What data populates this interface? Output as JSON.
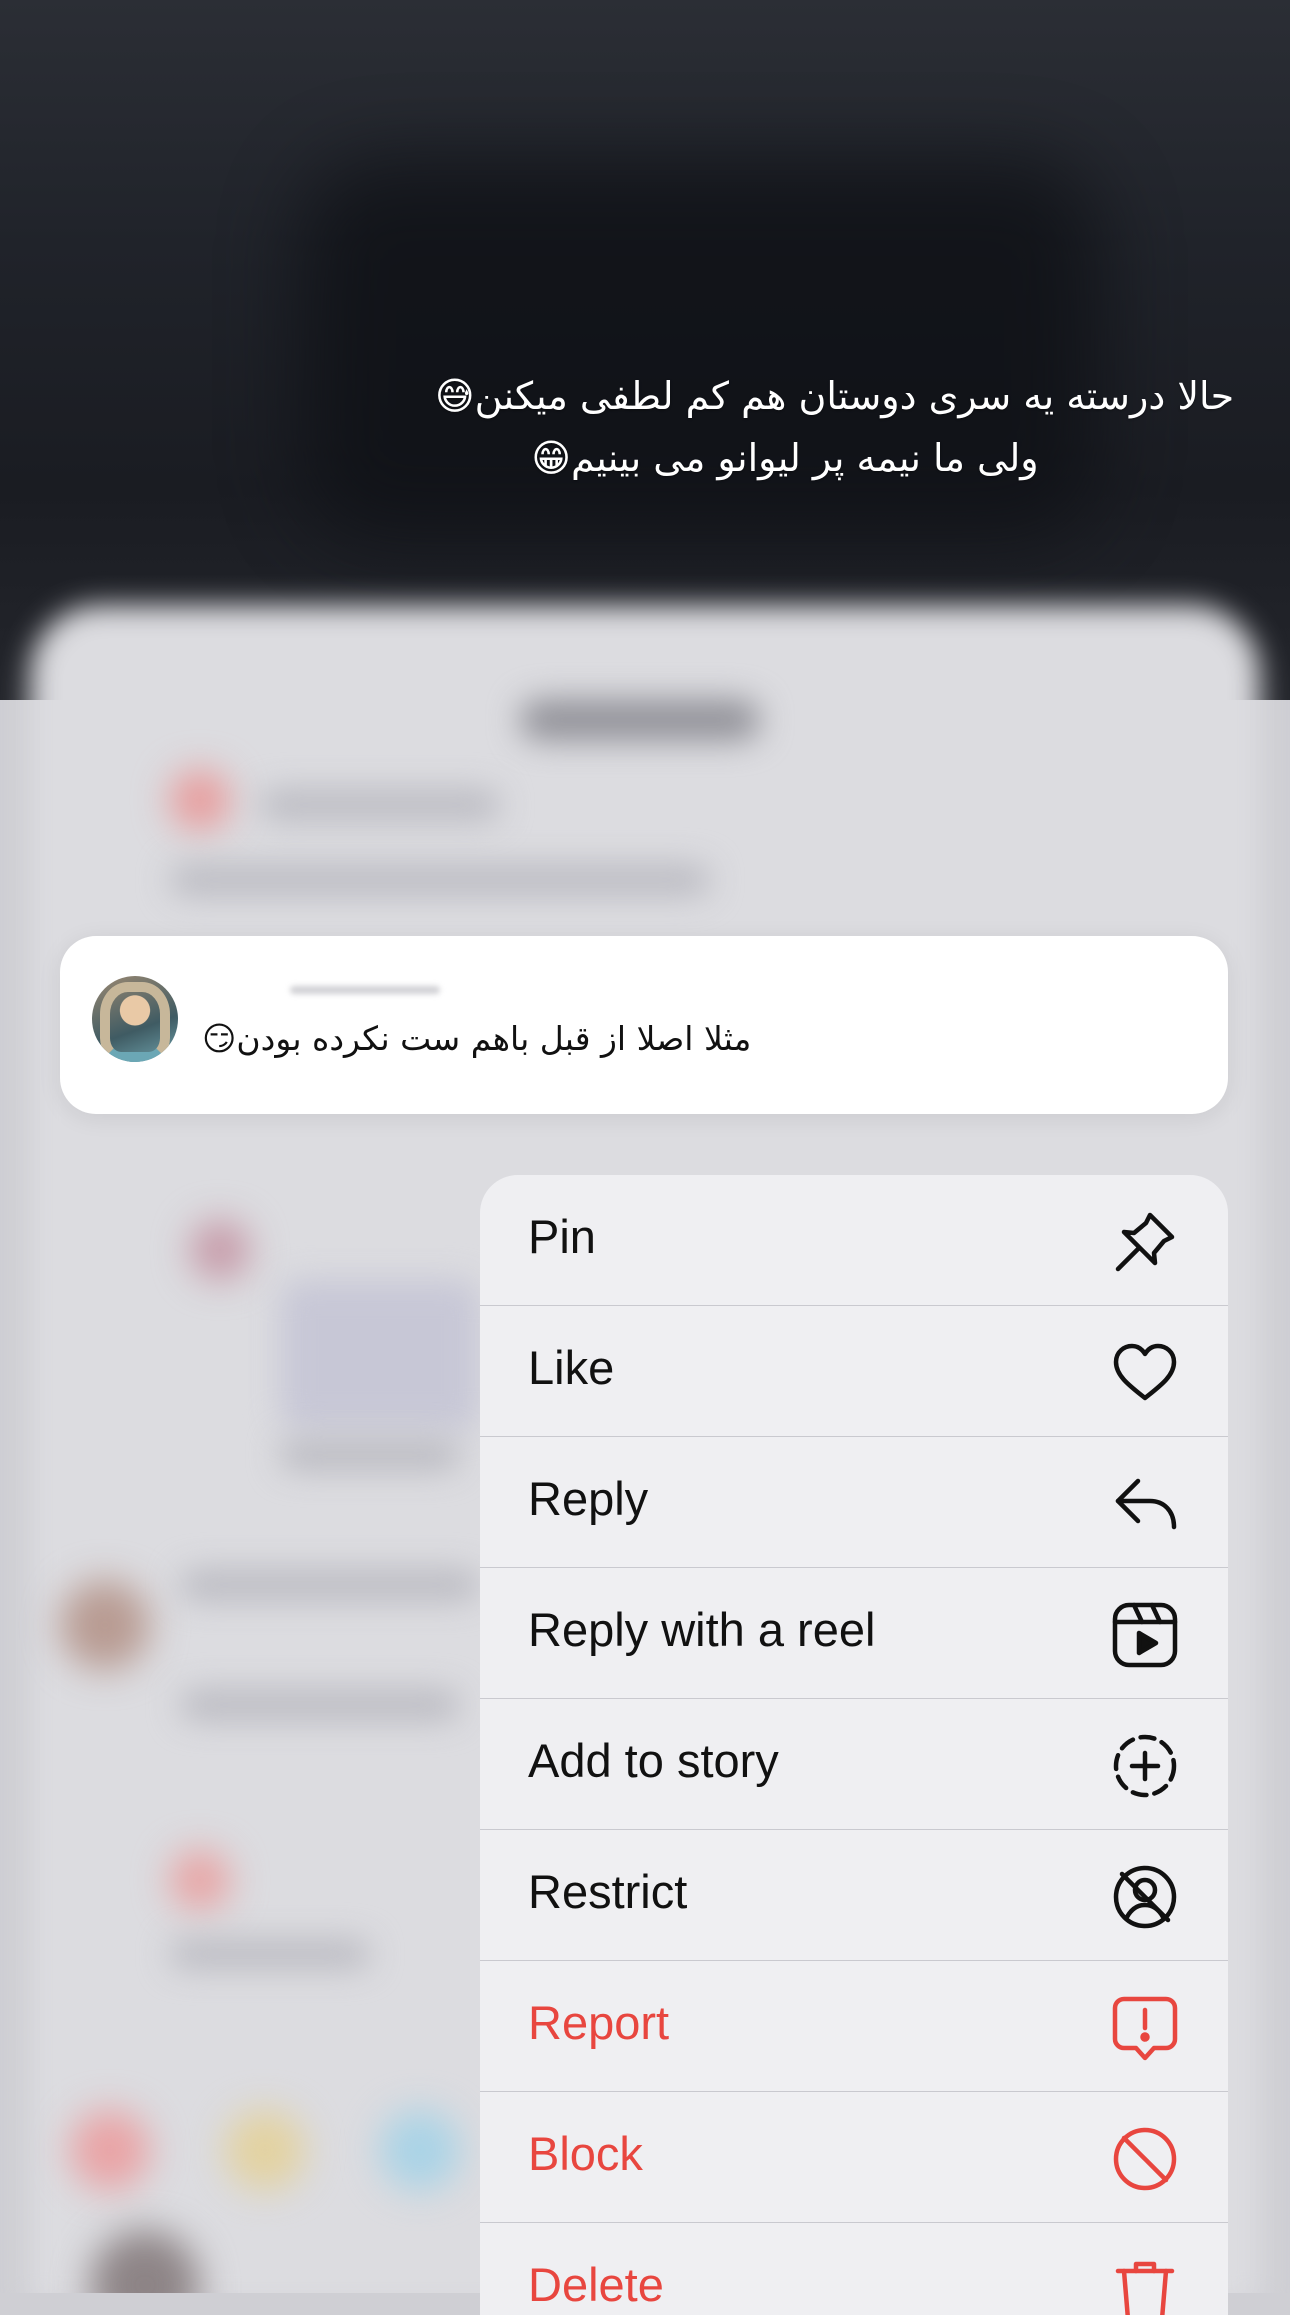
{
  "caption": {
    "line1": "حالا درسته یه سری دوستان هم کم لطفی میکنن😅",
    "line2": "ولی ما نیمه پر لیوانو می بینیم😁"
  },
  "comment": {
    "text": "مثلا اصلا از قبل باهم ست نکرده بودن😏"
  },
  "menu": {
    "items": [
      {
        "label": "Pin",
        "icon": "pin-icon"
      },
      {
        "label": "Like",
        "icon": "heart-icon"
      },
      {
        "label": "Reply",
        "icon": "reply-arrow-icon"
      },
      {
        "label": "Reply with a reel",
        "icon": "reel-icon"
      },
      {
        "label": "Add to story",
        "icon": "add-story-icon"
      },
      {
        "label": "Restrict",
        "icon": "restrict-icon"
      },
      {
        "label": "Report",
        "icon": "report-icon"
      },
      {
        "label": "Block",
        "icon": "block-icon"
      },
      {
        "label": "Delete",
        "icon": "trash-icon"
      }
    ]
  },
  "colors": {
    "danger": "#e8463f",
    "menu_bg": "#efeff2",
    "card_bg": "#ffffff"
  }
}
